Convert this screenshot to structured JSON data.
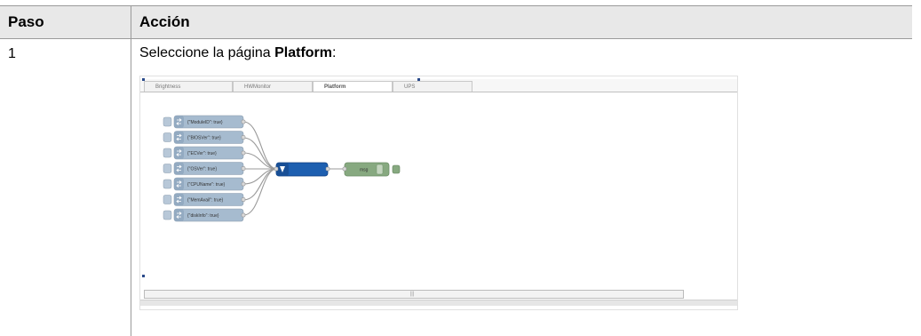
{
  "table": {
    "headers": {
      "paso": "Paso",
      "accion": "Acción"
    },
    "rows": [
      {
        "step": "1",
        "instruction_prefix": "Seleccione la página ",
        "instruction_bold": "Platform",
        "instruction_suffix": ":"
      }
    ]
  },
  "screenshot": {
    "tabs": [
      {
        "label": "Brightness",
        "active": false
      },
      {
        "label": "HWMonitor",
        "active": false
      },
      {
        "label": "Platform",
        "active": true
      },
      {
        "label": "UPS",
        "active": false
      }
    ],
    "inject_nodes": [
      "{\"ModuleID\": true}",
      "{\"BIOSVer\": true}",
      "{\"ECVer\": true}",
      "{\"OSVer\": true}",
      "{\"CPUName\": true}",
      "{\"MemAvail\": true}",
      "{\"diskInfo\": true}"
    ],
    "debug_node": {
      "label": "msg"
    },
    "colors": {
      "inject_node": "#a6bbcf",
      "function_node": "#1d5fb0",
      "debug_node": "#87a980"
    }
  }
}
